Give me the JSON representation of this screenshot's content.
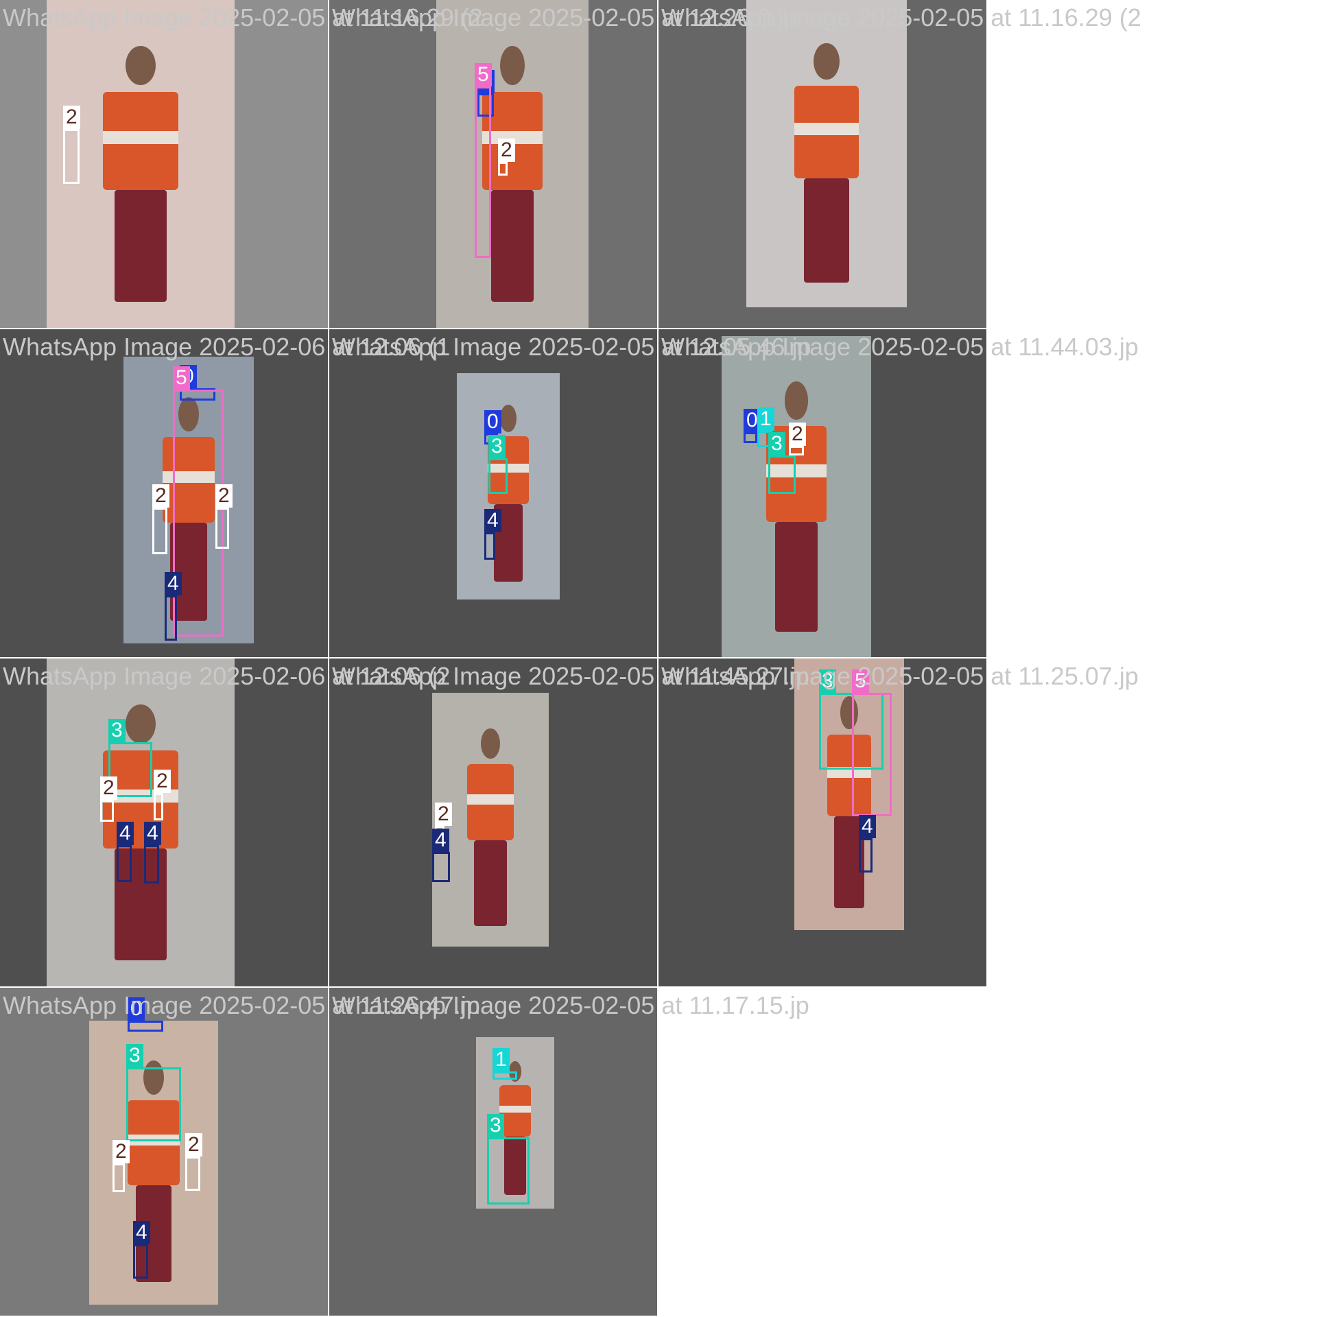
{
  "classes": [
    {
      "id": "0",
      "color": "#1f3bdc",
      "text_color": "#ffffff"
    },
    {
      "id": "1",
      "color": "#16d6d6",
      "text_color": "#ffffff"
    },
    {
      "id": "2",
      "color": "#ffffff",
      "text_color": "#5a2a1e"
    },
    {
      "id": "3",
      "color": "#16cfae",
      "text_color": "#ffffff"
    },
    {
      "id": "4",
      "color": "#1a2a78",
      "text_color": "#ffffff"
    },
    {
      "id": "5",
      "color": "#f06cc8",
      "text_color": "#ffffff"
    }
  ],
  "tiles": [
    {
      "caption": "WhatsApp Image 2025-02-05 at 11.16.29 (2",
      "background": "#8f8f8f",
      "detections": [
        {
          "class": "2"
        }
      ]
    },
    {
      "caption": "WhatsApp Image 2025-02-05 at 12.26.0.jp",
      "background": "#6f6f6f",
      "detections": [
        {
          "class": "0"
        },
        {
          "class": "5"
        },
        {
          "class": "2"
        }
      ]
    },
    {
      "caption": "WhatsApp Image 2025-02-05 at 11.16.29 (2",
      "background": "#666666",
      "detections": []
    },
    {
      "caption": "WhatsApp Image 2025-02-06 at 12.06 (1",
      "background": "#4f4f4f",
      "detections": [
        {
          "class": "0"
        },
        {
          "class": "5"
        },
        {
          "class": "2"
        },
        {
          "class": "2"
        },
        {
          "class": "4"
        }
      ]
    },
    {
      "caption": "WhatsApp Image 2025-02-05 at 12.05.46.jp",
      "background": "#4f4f4f",
      "detections": [
        {
          "class": "0"
        },
        {
          "class": "3"
        },
        {
          "class": "4"
        }
      ]
    },
    {
      "caption": "WhatsApp Image 2025-02-05 at 11.44.03.jp",
      "background": "#4f4f4f",
      "detections": [
        {
          "class": "0"
        },
        {
          "class": "1"
        },
        {
          "class": "3"
        },
        {
          "class": "2"
        }
      ]
    },
    {
      "caption": "WhatsApp Image 2025-02-06 at 12.06 (2",
      "background": "#4f4f4f",
      "detections": [
        {
          "class": "3"
        },
        {
          "class": "2"
        },
        {
          "class": "2"
        },
        {
          "class": "4"
        },
        {
          "class": "4"
        }
      ]
    },
    {
      "caption": "WhatsApp Image 2025-02-05 at 11.45.27.jp",
      "background": "#4f4f4f",
      "detections": [
        {
          "class": "2"
        },
        {
          "class": "4"
        }
      ]
    },
    {
      "caption": "WhatsApp Image 2025-02-05 at 11.25.07.jp",
      "background": "#4f4f4f",
      "detections": [
        {
          "class": "3"
        },
        {
          "class": "5"
        },
        {
          "class": "4"
        }
      ]
    },
    {
      "caption": "WhatsApp Image 2025-02-05 at 11.26.47.jp",
      "background": "#7a7a7a",
      "detections": [
        {
          "class": "0"
        },
        {
          "class": "3"
        },
        {
          "class": "2"
        },
        {
          "class": "2"
        },
        {
          "class": "4"
        }
      ]
    },
    {
      "caption": "WhatsApp Image 2025-02-05 at 11.17.15.jp",
      "background": "#666666",
      "detections": [
        {
          "class": "1"
        },
        {
          "class": "3"
        }
      ]
    }
  ]
}
